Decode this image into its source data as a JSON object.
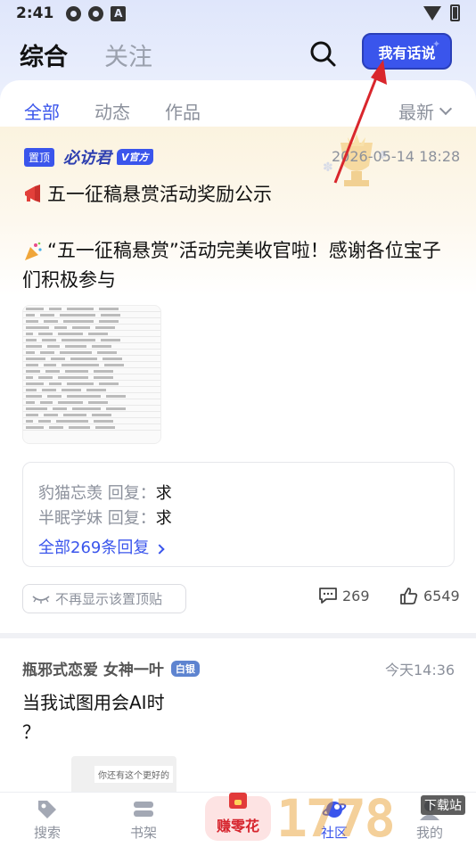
{
  "status_bar": {
    "time": "2:41",
    "a_icon_letter": "A"
  },
  "header": {
    "tabs": [
      "综合",
      "关注"
    ],
    "active_tab": "综合",
    "speak_button": "我有话说"
  },
  "subtabs": {
    "items": [
      "全部",
      "动态",
      "作品"
    ],
    "active": "全部",
    "sort_label": "最新"
  },
  "pinned_post": {
    "badge": "置顶",
    "author": "必访君",
    "author_badge": "V官方",
    "time": "2026-05-14 18:28",
    "title": "五一征稿悬赏活动奖励公示",
    "body_line1": "“五一征稿悬赏”活动完美收官啦！感谢各位宝子",
    "body_line2": "们积极参与",
    "replies": [
      {
        "user": "豹猫忘羡 回复：",
        "text": "求"
      },
      {
        "user": "半眠学妹 回复：",
        "text": "求"
      }
    ],
    "all_replies_label": "全部269条回复",
    "hide_pin_label": "不再显示该置顶贴",
    "comment_count": "269",
    "like_count": "6549"
  },
  "second_post": {
    "author": "瓶邪式恋爱 女神一叶",
    "author_badge": "白银",
    "time": "今天14:36",
    "body_line1": "当我试图用会AI时",
    "body_line2": "？",
    "thumb_text": "你还有这个更好的"
  },
  "bottom_nav": {
    "search": "搜索",
    "shelf": "书架",
    "earn": "赚零花",
    "community": "社区",
    "mine": "我的"
  },
  "watermark": {
    "digits": "1778",
    "tag": "下载站"
  },
  "colors": {
    "accent": "#3a55ec",
    "annotation_arrow": "#d9262c",
    "earn_red": "#d6242d"
  }
}
